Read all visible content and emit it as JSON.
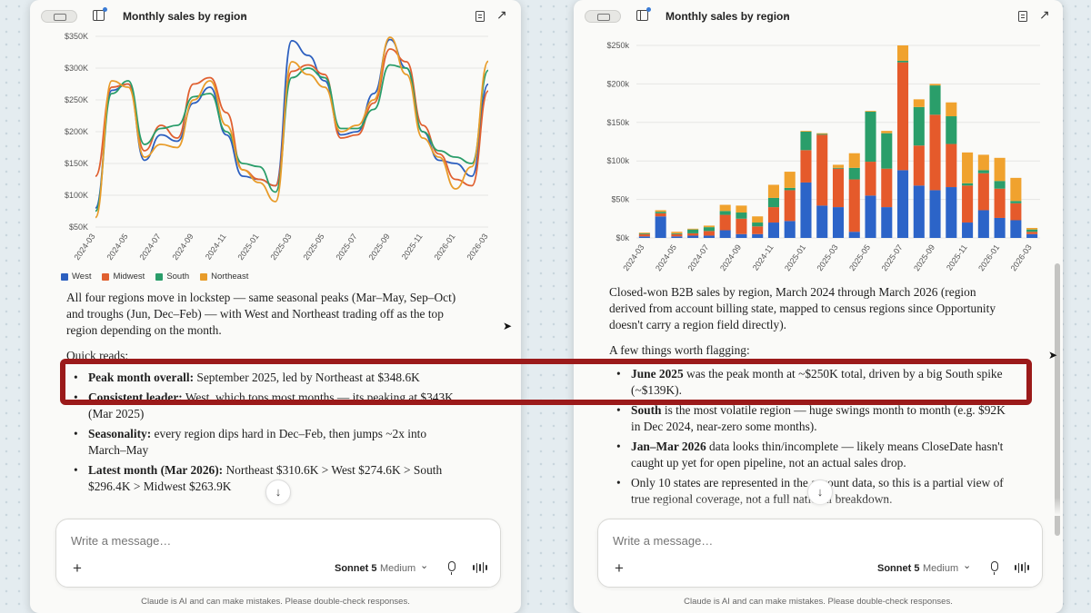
{
  "left_panel": {
    "title": "Monthly sales by region",
    "chart_data": {
      "type": "line",
      "x": [
        "2024-03",
        "2024-04",
        "2024-05",
        "2024-06",
        "2024-07",
        "2024-08",
        "2024-09",
        "2024-10",
        "2024-11",
        "2024-12",
        "2025-01",
        "2025-02",
        "2025-03",
        "2025-04",
        "2025-05",
        "2025-06",
        "2025-07",
        "2025-08",
        "2025-09",
        "2025-10",
        "2025-11",
        "2025-12",
        "2026-01",
        "2026-02",
        "2026-03"
      ],
      "x_tick_labels": [
        "2024-03",
        "2024-05",
        "2024-07",
        "2024-09",
        "2024-11",
        "2025-01",
        "2025-03",
        "2025-05",
        "2025-07",
        "2025-09",
        "2025-11",
        "2026-01",
        "2026-03"
      ],
      "y_tick_labels": [
        "$50K",
        "$100K",
        "$150K",
        "$200K",
        "$250K",
        "$300K",
        "$350K"
      ],
      "ylim": [
        50000,
        350000
      ],
      "series": [
        {
          "name": "West",
          "color": "#2c5fbf",
          "values": [
            80000,
            265000,
            275000,
            155000,
            195000,
            185000,
            245000,
            270000,
            195000,
            130000,
            125000,
            115000,
            343000,
            320000,
            280000,
            195000,
            200000,
            260000,
            345000,
            300000,
            200000,
            155000,
            150000,
            130000,
            274600
          ]
        },
        {
          "name": "Midwest",
          "color": "#e06030",
          "values": [
            130000,
            270000,
            275000,
            170000,
            210000,
            190000,
            275000,
            285000,
            230000,
            140000,
            125000,
            115000,
            295000,
            305000,
            290000,
            190000,
            195000,
            245000,
            330000,
            310000,
            210000,
            165000,
            125000,
            115000,
            263900
          ]
        },
        {
          "name": "South",
          "color": "#2a9d6a",
          "values": [
            75000,
            260000,
            280000,
            180000,
            205000,
            210000,
            255000,
            260000,
            200000,
            150000,
            145000,
            105000,
            285000,
            300000,
            285000,
            205000,
            205000,
            235000,
            305000,
            300000,
            200000,
            170000,
            160000,
            150000,
            296400
          ]
        },
        {
          "name": "Northeast",
          "color": "#e89c2a",
          "values": [
            65000,
            280000,
            270000,
            160000,
            180000,
            175000,
            250000,
            280000,
            210000,
            140000,
            120000,
            90000,
            310000,
            290000,
            270000,
            200000,
            210000,
            250000,
            348600,
            290000,
            190000,
            160000,
            110000,
            145000,
            310600
          ]
        }
      ]
    },
    "paragraph": "All four regions move in lockstep — same seasonal peaks (Mar–May, Sep–Oct) and troughs (Jun, Dec–Feb) — with West and Northeast trading off as the top region depending on the month.",
    "quick_reads_label": "Quick reads:",
    "bullets": [
      {
        "bold": "Peak month overall:",
        "text": " September 2025, led by Northeast at $348.6K"
      },
      {
        "bold": "Consistent leader:",
        "text": " West, which tops most months — its peaking at $343K (Mar 2025)"
      },
      {
        "bold": "Seasonality:",
        "text": " every region dips hard in Dec–Feb, then jumps ~2x into March–May"
      },
      {
        "bold": "Latest month (Mar 2026):",
        "text": " Northeast $310.6K > West $274.6K > South $296.4K > Midwest $263.9K"
      }
    ],
    "scroll_down_icon": "↓",
    "composer_placeholder": "Write a message…",
    "plus_icon": "+",
    "model": "Sonnet 5",
    "effort": "Medium",
    "disclaimer": "Claude is AI and can make mistakes. Please double-check responses."
  },
  "right_panel": {
    "title": "Monthly sales by region",
    "chart_data": {
      "type": "bar",
      "stacked": true,
      "categories": [
        "2024-03",
        "2024-04",
        "2024-05",
        "2024-06",
        "2024-07",
        "2024-08",
        "2024-09",
        "2024-10",
        "2024-11",
        "2024-12",
        "2025-01",
        "2025-02",
        "2025-03",
        "2025-04",
        "2025-05",
        "2025-06",
        "2025-07",
        "2025-08",
        "2025-09",
        "2025-10",
        "2025-11",
        "2025-12",
        "2026-01",
        "2026-02",
        "2026-03"
      ],
      "x_tick_labels": [
        "2024-03",
        "2024-05",
        "2024-07",
        "2024-09",
        "2024-11",
        "2025-01",
        "2025-03",
        "2025-05",
        "2025-07",
        "2025-09",
        "2025-11",
        "2026-01",
        "2026-03"
      ],
      "y_tick_labels": [
        "$0k",
        "$50k",
        "$100k",
        "$150k",
        "$200k",
        "$250k"
      ],
      "ylim": [
        0,
        250000
      ],
      "series": [
        {
          "name": "West",
          "color": "#2c64c8",
          "values": [
            2000,
            28000,
            2000,
            3000,
            3000,
            10000,
            5000,
            5000,
            20000,
            22000,
            72000,
            42000,
            40000,
            8000,
            55000,
            40000,
            88000,
            68000,
            62000,
            66000,
            20000,
            36000,
            26000,
            23000,
            5000
          ]
        },
        {
          "name": "Midwest",
          "color": "#e55a2b",
          "values": [
            3000,
            4000,
            3000,
            3000,
            6000,
            20000,
            20000,
            10000,
            20000,
            40000,
            42000,
            92000,
            50000,
            68000,
            44000,
            50000,
            140000,
            52000,
            98000,
            56000,
            48000,
            48000,
            38000,
            22000,
            3000
          ]
        },
        {
          "name": "South",
          "color": "#2a9e6a",
          "values": [
            1000,
            2000,
            1000,
            5000,
            5000,
            5000,
            8000,
            5000,
            12000,
            3000,
            24000,
            1000,
            1000,
            15000,
            65000,
            46000,
            2000,
            50000,
            38000,
            36000,
            3000,
            4000,
            10000,
            3000,
            3000
          ]
        },
        {
          "name": "Northeast",
          "color": "#f0a22e",
          "values": [
            1000,
            2000,
            2000,
            1000,
            2000,
            8000,
            9000,
            8000,
            17000,
            21000,
            1000,
            1000,
            4000,
            19000,
            1000,
            3000,
            20000,
            10000,
            2000,
            18000,
            40000,
            20000,
            30000,
            30000,
            2000
          ]
        }
      ]
    },
    "paragraph": "Closed-won B2B sales by region, March 2024 through March 2026 (region derived from account billing state, mapped to census regions since Opportunity doesn't carry a region field directly).",
    "flagging_label": "A few things worth flagging:",
    "bullets": [
      {
        "bold": "June 2025",
        "text": " was the peak month at ~$250K total, driven by a big South spike (~$139K)."
      },
      {
        "bold": "South",
        "text": " is the most volatile region — huge swings month to month (e.g. $92K in Dec 2024, near-zero some months)."
      },
      {
        "bold": "Jan–Mar 2026",
        "text": " data looks thin/incomplete — likely means CloseDate hasn't caught up yet for open pipeline, not an actual sales drop."
      },
      {
        "bold": "",
        "text": "Only 10 states are represented in the account data, so this is a partial view of true regional coverage, not a full national breakdown."
      }
    ],
    "scroll_down_icon": "↓",
    "composer_placeholder": "Write a message…",
    "plus_icon": "+",
    "model": "Sonnet 5",
    "effort": "Medium",
    "disclaimer": "Claude is AI and can make mistakes. Please double-check responses."
  }
}
